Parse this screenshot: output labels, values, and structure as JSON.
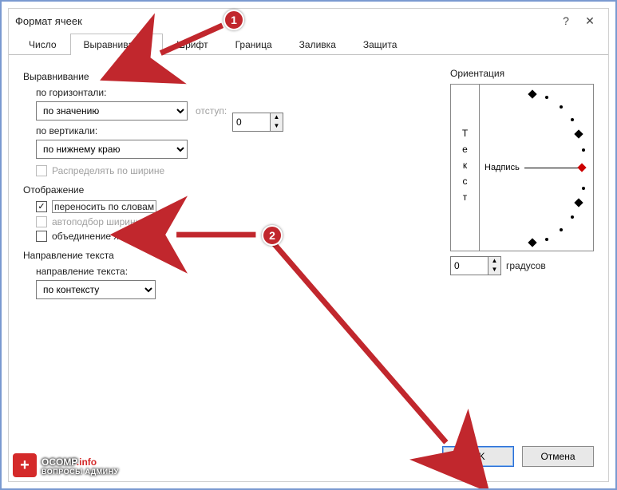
{
  "window": {
    "title": "Формат ячеек",
    "help": "?",
    "close": "✕"
  },
  "tabs": {
    "items": [
      {
        "label": "Число"
      },
      {
        "label": "Выравнивание"
      },
      {
        "label": "Шрифт"
      },
      {
        "label": "Граница"
      },
      {
        "label": "Заливка"
      },
      {
        "label": "Защита"
      }
    ]
  },
  "alignment": {
    "group_label": "Выравнивание",
    "horizontal_label": "по горизонтали:",
    "horizontal_value": "по значению",
    "indent_label": "отступ:",
    "indent_value": "0",
    "vertical_label": "по вертикали:",
    "vertical_value": "по нижнему краю",
    "distribute_label": "Распределять по ширине"
  },
  "display": {
    "group_label": "Отображение",
    "wrap_label": "переносить по словам",
    "shrink_label": "автоподбор ширины",
    "merge_label": "объединение ячеек"
  },
  "direction": {
    "group_label": "Направление текста",
    "label": "направление текста:",
    "value": "по контексту"
  },
  "orientation": {
    "group_label": "Ориентация",
    "vertical_text": "Текст",
    "dial_label": "Надпись",
    "degrees_value": "0",
    "degrees_label": "градусов"
  },
  "buttons": {
    "ok": "OK",
    "cancel": "Отмена"
  },
  "annotations": {
    "c1": "1",
    "c2": "2"
  },
  "logo": {
    "line1a": "OCOMP",
    "line1b": ".info",
    "line2": "ВОПРОСЫ АДМИНУ",
    "plus": "+"
  }
}
